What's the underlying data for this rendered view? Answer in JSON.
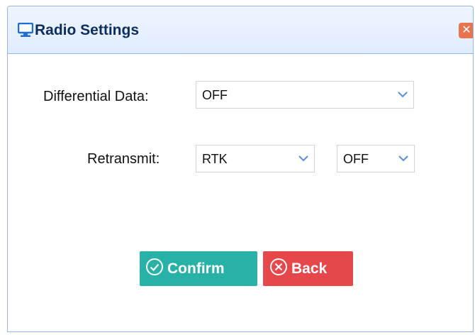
{
  "dialog": {
    "title": "Radio Settings",
    "title_icon": "monitor-icon",
    "close_icon": "close-icon",
    "close_glyph": "✕"
  },
  "form": {
    "differential_data": {
      "label": "Differential Data:",
      "value": "OFF"
    },
    "retransmit": {
      "label": "Retransmit:",
      "mode_value": "RTK",
      "state_value": "OFF"
    }
  },
  "buttons": {
    "confirm_label": "Confirm",
    "confirm_icon": "check-circle-icon",
    "back_label": "Back",
    "back_icon": "x-circle-icon"
  },
  "colors": {
    "confirm": "#27b1a7",
    "back": "#e5474b",
    "title_text": "#0e2d5f",
    "header_border": "#95b8e7"
  }
}
